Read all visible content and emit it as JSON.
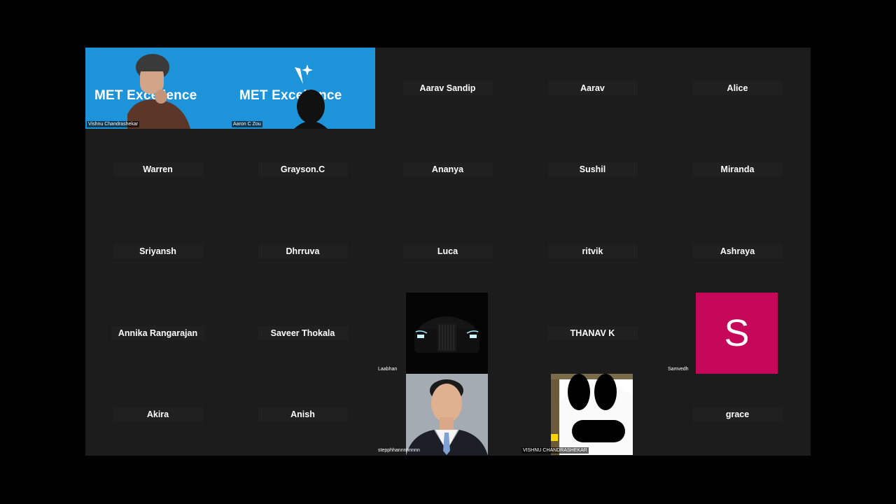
{
  "gallery": {
    "video_tiles": [
      {
        "overlay_text": "MET Excellence",
        "label": "Vishnu Chandrashekar"
      },
      {
        "overlay_text": "MET Excellence",
        "label": "Aaron C Zou"
      }
    ],
    "name_tiles": [
      "Aarav Sandip",
      "Aarav",
      "Alice",
      "Warren",
      "Grayson.C",
      "Ananya",
      "Sushil",
      "Miranda",
      "Sriyansh",
      "Dhrruva",
      "Luca",
      "ritvik",
      "Ashraya",
      "Annika Rangarajan",
      "Saveer Thokala",
      "THANAV K",
      "Akira",
      "Anish",
      "grace"
    ],
    "image_tiles": {
      "laabhan": {
        "label": "Laabhan"
      },
      "samvedh": {
        "label": "Samvedh",
        "avatar_letter": "S",
        "avatar_color": "#c5085a"
      },
      "stepph": {
        "label": "stepphhannnnnnnn"
      },
      "vishnu2": {
        "label": "VISHNU CHANDRASHEKAR"
      }
    }
  }
}
